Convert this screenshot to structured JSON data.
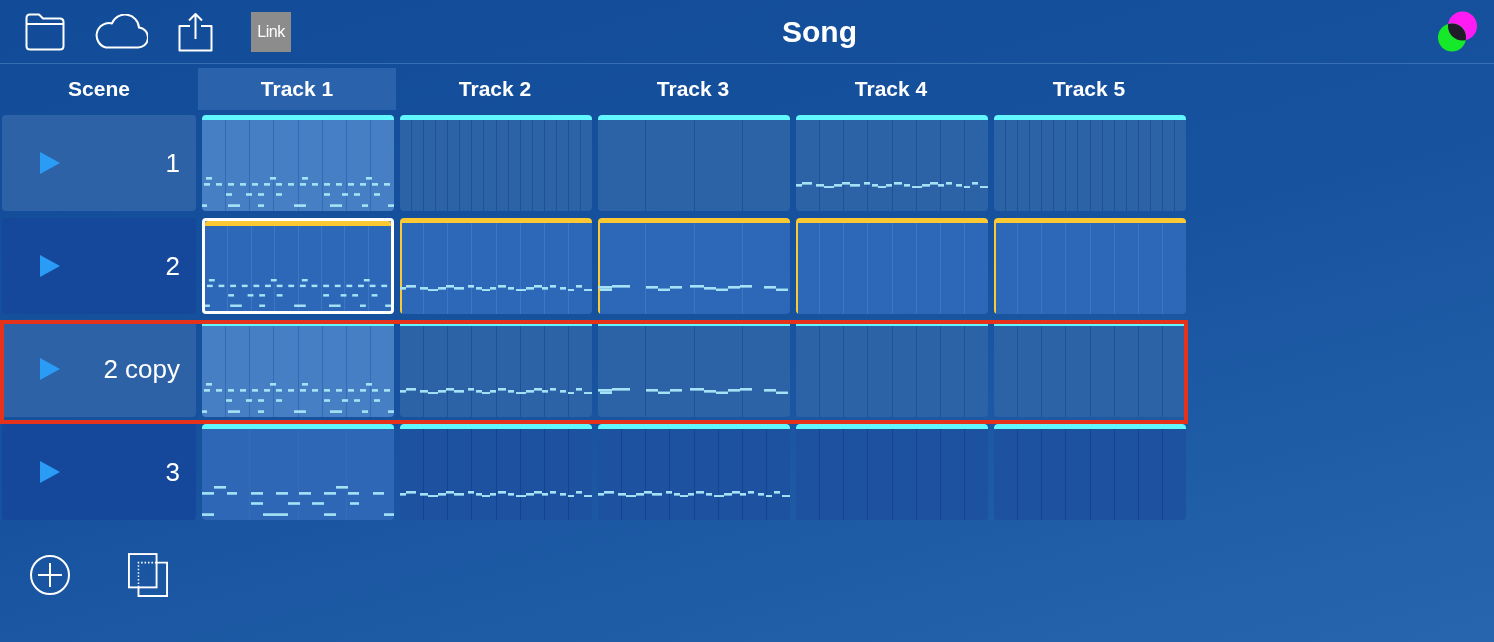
{
  "topbar": {
    "link_label": "Link",
    "title": "Song"
  },
  "scene_header": "Scene",
  "tracks": [
    {
      "name": "Track 1",
      "selected": true
    },
    {
      "name": "Track 2",
      "selected": false
    },
    {
      "name": "Track 3",
      "selected": false
    },
    {
      "name": "Track 4",
      "selected": false
    },
    {
      "name": "Track 5",
      "selected": false
    }
  ],
  "scenes": [
    {
      "name": "1",
      "selected": true,
      "highlighted": false,
      "clips": [
        {
          "kind": "drums",
          "grid": {
            "kind": "medium"
          },
          "playing": false,
          "selected": false
        },
        {
          "kind": "empty",
          "grid": {
            "kind": "fine"
          },
          "playing": false,
          "selected": false
        },
        {
          "kind": "empty",
          "grid": {
            "kind": "coarse"
          },
          "playing": false,
          "selected": false
        },
        {
          "kind": "melody",
          "grid": {
            "kind": "medium"
          },
          "playing": false,
          "selected": false
        },
        {
          "kind": "empty",
          "grid": {
            "kind": "fine"
          },
          "playing": false,
          "selected": false
        }
      ]
    },
    {
      "name": "2",
      "selected": false,
      "highlighted": false,
      "clips": [
        {
          "kind": "drums",
          "grid": {
            "kind": "medium"
          },
          "playing": true,
          "selected": true
        },
        {
          "kind": "melody",
          "grid": {
            "kind": "medium"
          },
          "playing": true,
          "selected": false
        },
        {
          "kind": "slow",
          "grid": {
            "kind": "coarse"
          },
          "playing": true,
          "selected": false
        },
        {
          "kind": "empty",
          "grid": {
            "kind": "medium"
          },
          "playing": true,
          "selected": false
        },
        {
          "kind": "empty",
          "grid": {
            "kind": "medium"
          },
          "playing": true,
          "selected": false
        }
      ]
    },
    {
      "name": "2 copy",
      "selected": true,
      "highlighted": true,
      "clips": [
        {
          "kind": "drums",
          "grid": {
            "kind": "medium"
          },
          "playing": false,
          "selected": false
        },
        {
          "kind": "melody",
          "grid": {
            "kind": "medium"
          },
          "playing": false,
          "selected": false
        },
        {
          "kind": "slow",
          "grid": {
            "kind": "coarse"
          },
          "playing": false,
          "selected": false
        },
        {
          "kind": "empty",
          "grid": {
            "kind": "medium"
          },
          "playing": false,
          "selected": false
        },
        {
          "kind": "empty",
          "grid": {
            "kind": "medium"
          },
          "playing": false,
          "selected": false
        }
      ]
    },
    {
      "name": "3",
      "selected": false,
      "highlighted": false,
      "clips": [
        {
          "kind": "beat",
          "grid": {
            "kind": "coarse"
          },
          "playing": false,
          "selected": false
        },
        {
          "kind": "melody",
          "grid": {
            "kind": "medium"
          },
          "playing": false,
          "selected": false
        },
        {
          "kind": "melody",
          "grid": {
            "kind": "medium"
          },
          "playing": false,
          "selected": false
        },
        {
          "kind": "empty",
          "grid": {
            "kind": "medium"
          },
          "playing": false,
          "selected": false
        },
        {
          "kind": "empty",
          "grid": {
            "kind": "medium"
          },
          "playing": false,
          "selected": false
        }
      ]
    }
  ]
}
